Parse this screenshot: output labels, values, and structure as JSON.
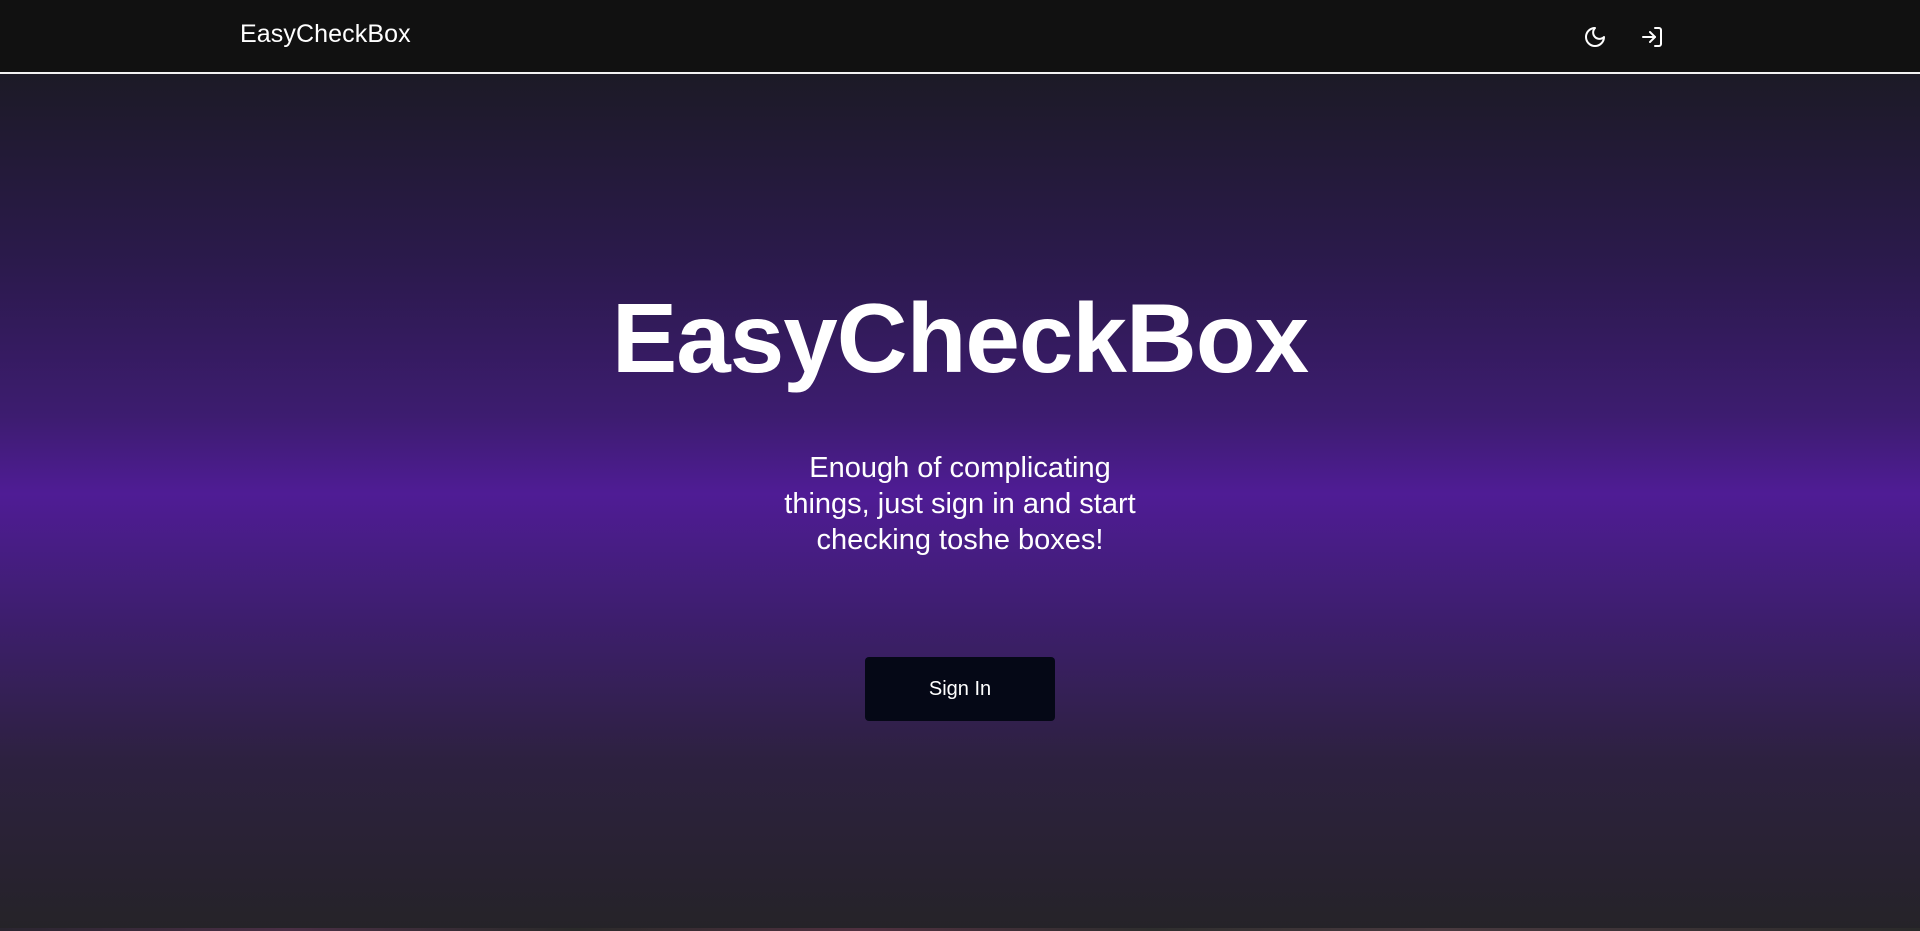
{
  "navbar": {
    "brand": "EasyCheckBox",
    "theme_icon": "moon-icon",
    "login_icon": "log-in-icon"
  },
  "hero": {
    "title": "EasyCheckBox",
    "subtitle": "Enough of complicating things, just sign in and start checking toshe boxes!",
    "button_label": "Sign In"
  },
  "colors": {
    "navbar_bg": "#111111",
    "accent_purple": "#4f1c95",
    "button_bg": "#050816",
    "text": "#ffffff"
  }
}
